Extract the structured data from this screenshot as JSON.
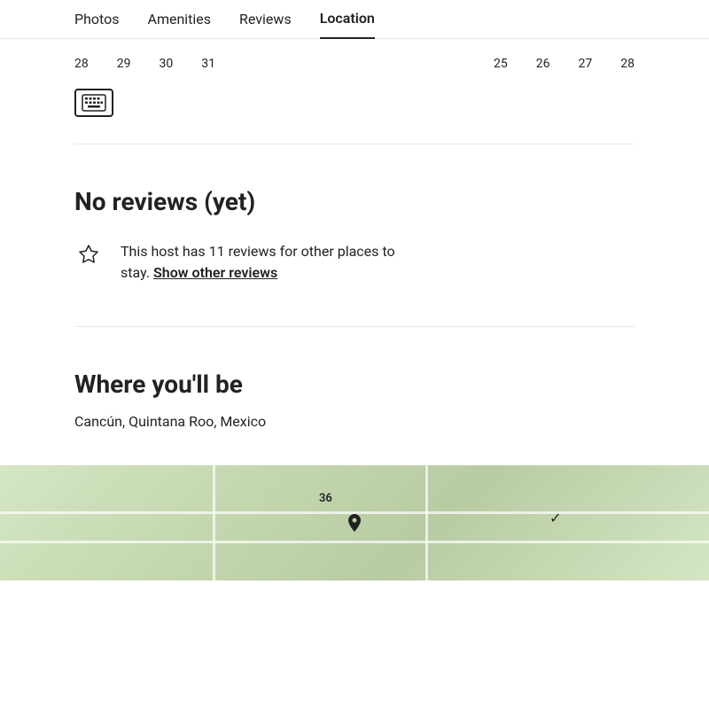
{
  "nav": {
    "items": [
      {
        "label": "Photos",
        "active": false
      },
      {
        "label": "Amenities",
        "active": false
      },
      {
        "label": "Reviews",
        "active": false
      },
      {
        "label": "Location",
        "active": true
      }
    ]
  },
  "calendar": {
    "left_dates": [
      "28",
      "29",
      "30",
      "31"
    ],
    "right_dates": [
      "25",
      "26",
      "27",
      "28"
    ]
  },
  "keyboard": {
    "icon_label": "keyboard-icon"
  },
  "reviews": {
    "title": "No reviews (yet)",
    "host_text_before": "This host has 11 reviews for other places to",
    "host_text_mid": "stay.",
    "show_link": "Show other reviews"
  },
  "location": {
    "title": "Where you'll be",
    "subtitle": "Cancún, Quintana Roo, Mexico",
    "map_number": "36"
  }
}
